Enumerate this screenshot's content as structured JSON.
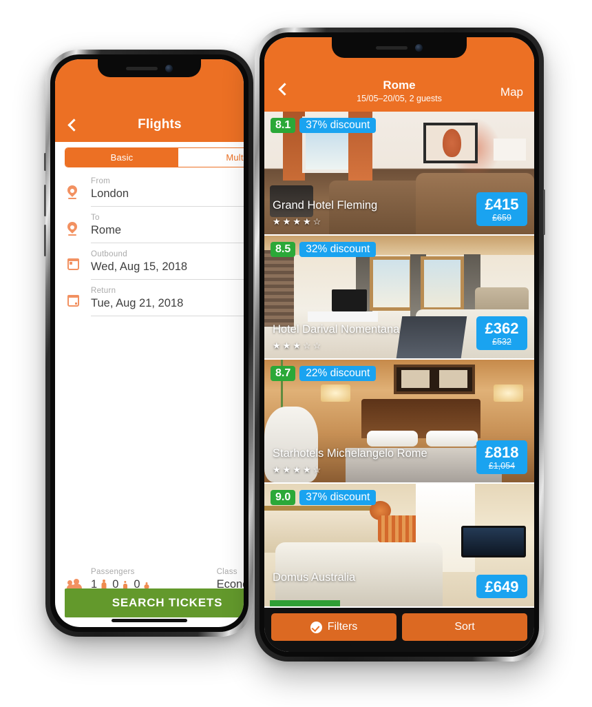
{
  "left_phone": {
    "app": "flights-booking",
    "header": {
      "title": "Flights",
      "back_icon": "chevron-left-icon"
    },
    "tabs": [
      {
        "label": "Basic",
        "selected": true
      },
      {
        "label": "Mult",
        "selected": false
      }
    ],
    "fields": [
      {
        "icon": "map-pin-icon",
        "label": "From",
        "value": "London"
      },
      {
        "icon": "map-pin-icon",
        "label": "To",
        "value": "Rome"
      },
      {
        "icon": "calendar-icon",
        "label": "Outbound",
        "value": "Wed, Aug 15, 2018"
      },
      {
        "icon": "calendar-icon",
        "label": "Return",
        "value": "Tue, Aug 21, 2018"
      }
    ],
    "passengers": {
      "icon": "people-icon",
      "label": "Passengers",
      "adults": "1",
      "children": "0",
      "infants": "0"
    },
    "travel_class": {
      "label": "Class",
      "value": "Econom"
    },
    "cta": {
      "label": "SEARCH TICKETS",
      "color": "#63992c"
    }
  },
  "right_phone": {
    "app": "hotels-search-results",
    "header": {
      "back_icon": "chevron-left-icon",
      "city": "Rome",
      "subtitle": "15/05–20/05, 2 guests",
      "map_label": "Map"
    },
    "hotels": [
      {
        "rating": "8.1",
        "discount": "37% discount",
        "name": "Grand Hotel Fleming",
        "stars": 4,
        "price": "£415",
        "was": "£659"
      },
      {
        "rating": "8.5",
        "discount": "32% discount",
        "name": "Hotel Darival Nomentana",
        "stars": 3,
        "price": "£362",
        "was": "£532"
      },
      {
        "rating": "8.7",
        "discount": "22% discount",
        "name": "Starhotels Michelangelo Rome",
        "stars": 4,
        "price": "£818",
        "was": "£1,054"
      },
      {
        "rating": "9.0",
        "discount": "37% discount",
        "name": "Domus Australia",
        "stars": 0,
        "price": "£649",
        "was": ""
      }
    ],
    "bottom_bar": [
      {
        "icon": "check-circle-icon",
        "label": "Filters"
      },
      {
        "icon": "",
        "label": "Sort"
      }
    ]
  },
  "colors": {
    "brand_orange": "#ec7024",
    "rating_green": "#2ba838",
    "price_blue": "#1aa3f0",
    "cta_green": "#63992c",
    "star_filled": "★",
    "star_empty": "☆"
  }
}
